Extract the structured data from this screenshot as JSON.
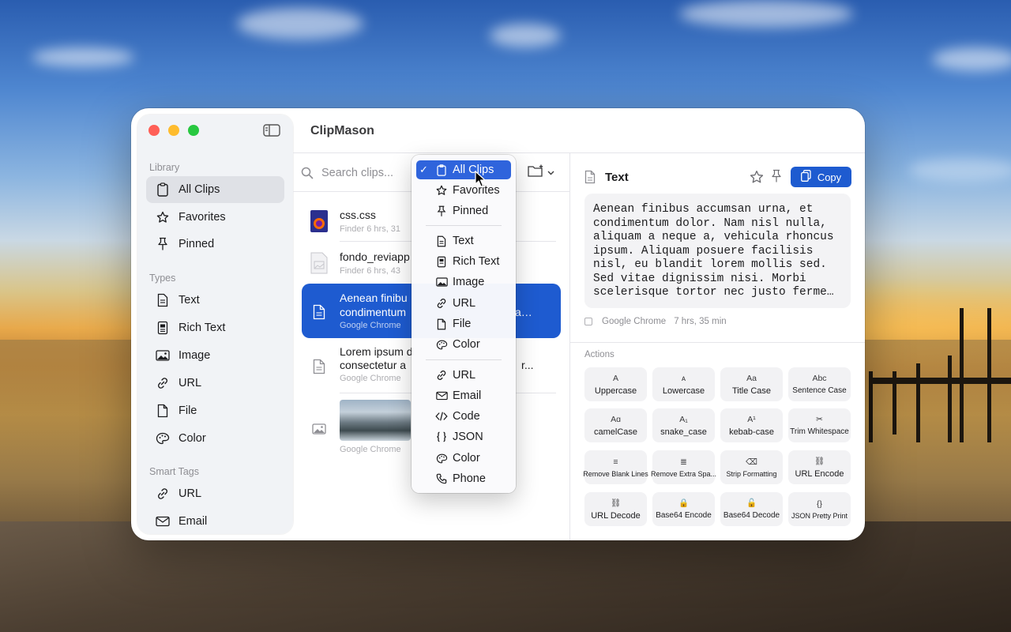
{
  "app": {
    "title": "ClipMason"
  },
  "sidebar": {
    "library_label": "Library",
    "library": [
      {
        "label": "All Clips",
        "icon": "clipboard-icon",
        "active": true
      },
      {
        "label": "Favorites",
        "icon": "star-icon"
      },
      {
        "label": "Pinned",
        "icon": "pin-icon"
      }
    ],
    "types_label": "Types",
    "types": [
      {
        "label": "Text",
        "icon": "document-icon"
      },
      {
        "label": "Rich Text",
        "icon": "rich-text-icon"
      },
      {
        "label": "Image",
        "icon": "image-icon"
      },
      {
        "label": "URL",
        "icon": "link-icon"
      },
      {
        "label": "File",
        "icon": "file-icon"
      },
      {
        "label": "Color",
        "icon": "palette-icon"
      }
    ],
    "smart_tags_label": "Smart Tags",
    "smart_tags": [
      {
        "label": "URL",
        "icon": "link-icon"
      },
      {
        "label": "Email",
        "icon": "envelope-icon"
      }
    ]
  },
  "list": {
    "search_placeholder": "Search clips...",
    "clips": [
      {
        "name": "css.css",
        "meta": "Finder  6 hrs, 31"
      },
      {
        "name": "fondo_reviapp",
        "meta": "Finder  6 hrs, 43"
      },
      {
        "line1": "Aenean finibu",
        "line2": "condimentum",
        "line2_tail": "a…",
        "meta": "Google Chrome",
        "selected": true
      },
      {
        "line1": "Lorem ipsum d",
        "line1_tail": "",
        "line2": "consectetur a",
        "line2_tail": "r...",
        "meta": "Google Chrome"
      },
      {
        "meta": "Google Chrome"
      }
    ]
  },
  "filter_menu": {
    "items": [
      {
        "label": "All Clips",
        "icon": "clipboard-icon",
        "checked": true
      },
      {
        "label": "Favorites",
        "icon": "star-icon"
      },
      {
        "label": "Pinned",
        "icon": "pin-icon"
      },
      {
        "label": "Text",
        "icon": "document-icon"
      },
      {
        "label": "Rich Text",
        "icon": "rich-text-icon"
      },
      {
        "label": "Image",
        "icon": "image-icon"
      },
      {
        "label": "URL",
        "icon": "link-icon"
      },
      {
        "label": "File",
        "icon": "file-icon"
      },
      {
        "label": "Color",
        "icon": "palette-icon"
      },
      {
        "label": "URL",
        "icon": "link-icon"
      },
      {
        "label": "Email",
        "icon": "envelope-icon"
      },
      {
        "label": "Code",
        "icon": "code-icon"
      },
      {
        "label": "JSON",
        "icon": "braces-icon"
      },
      {
        "label": "Color",
        "icon": "palette-icon"
      },
      {
        "label": "Phone",
        "icon": "phone-icon"
      }
    ],
    "checkmark": "✓"
  },
  "detail": {
    "type": "Text",
    "copy_label": "Copy",
    "preview_lines": [
      "Aenean finibus accumsan urna, et",
      "condimentum dolor. Nam nisl nulla,",
      "aliquam a neque a, vehicula rhoncus",
      "ipsum. Aliquam posuere facilisis",
      "nisl, eu blandit lorem mollis sed.",
      "Sed vitae dignissim nisi. Morbi",
      "scelerisque tortor nec justo ferme…"
    ],
    "source_app": "Google Chrome",
    "source_time": "7 hrs, 35 min",
    "actions_label": "Actions",
    "actions": [
      {
        "icon": "A",
        "label": "Uppercase"
      },
      {
        "icon": "ᴀ",
        "label": "Lowercase"
      },
      {
        "icon": "Aa",
        "label": "Title Case"
      },
      {
        "icon": "Abc",
        "label": "Sentence Case"
      },
      {
        "icon": "Aɑ",
        "label": "camelCase"
      },
      {
        "icon": "A₁",
        "label": "snake_case"
      },
      {
        "icon": "A¹",
        "label": "kebab-case"
      },
      {
        "icon": "✂",
        "label": "Trim Whitespace"
      },
      {
        "icon": "≡",
        "label": "Remove Blank Lines"
      },
      {
        "icon": "≣",
        "label": "Remove Extra Spa..."
      },
      {
        "icon": "⌫",
        "label": "Strip Formatting"
      },
      {
        "icon": "⛓",
        "label": "URL Encode"
      },
      {
        "icon": "⛓",
        "label": "URL Decode"
      },
      {
        "icon": "🔒",
        "label": "Base64 Encode"
      },
      {
        "icon": "🔓",
        "label": "Base64 Decode"
      },
      {
        "icon": "{}",
        "label": "JSON Pretty Print"
      }
    ]
  },
  "colors": {
    "accent": "#1e5bd0",
    "menu_highlight": "#2f64dc",
    "close": "#ff5f57",
    "minimize": "#febc2e",
    "zoom": "#28c840"
  }
}
